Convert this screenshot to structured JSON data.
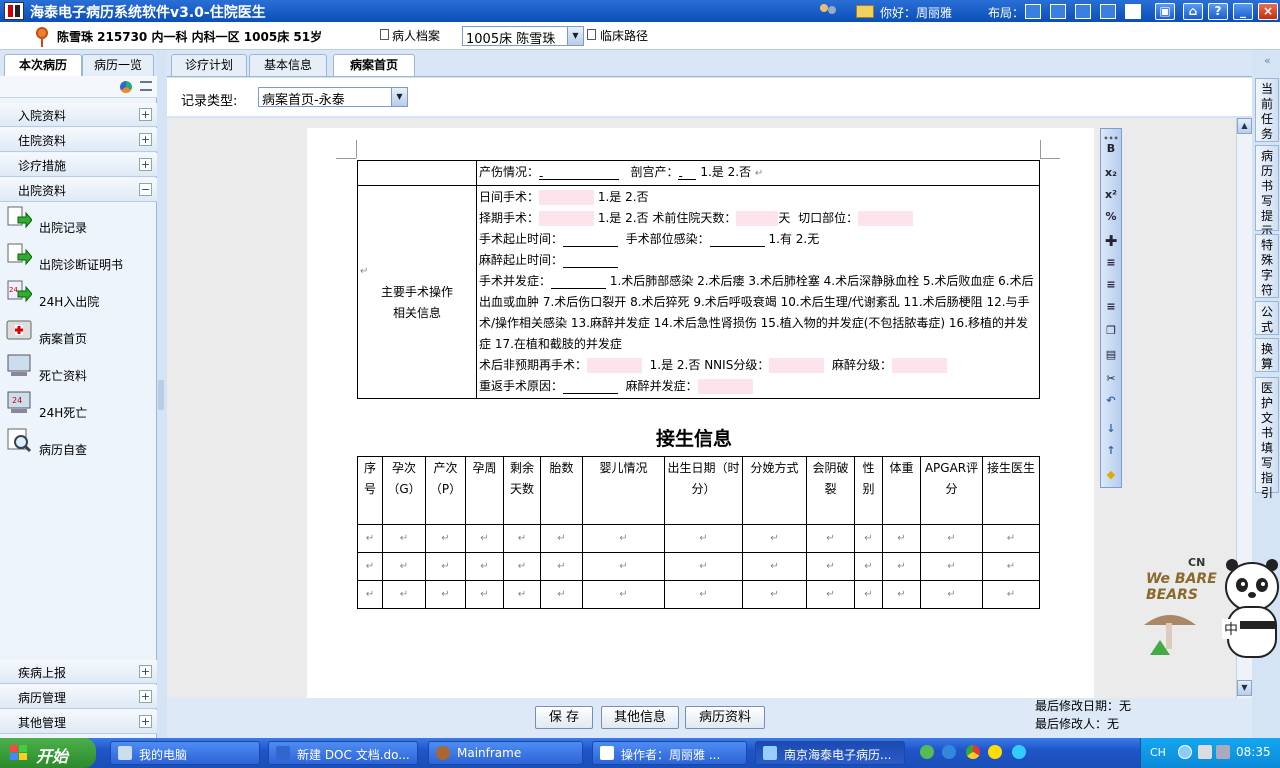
{
  "titlebar": {
    "title": "海泰电子病历系统软件v3.0-住院医生",
    "greeting": "你好：周丽雅",
    "layout_label": "布局：",
    "close": "×",
    "help": "?",
    "minimize": "_"
  },
  "patient": {
    "info": "陈雪珠 215730 内一科 内科一区 1005床 51岁",
    "archive_label": "病人档案",
    "bed_selected": "1005床 陈雪珠",
    "clinical_path": "临床路径"
  },
  "sidebar": {
    "tabs": [
      "本次病历",
      "病历一览"
    ],
    "groups": [
      "入院资料",
      "住院资料",
      "诊疗措施",
      "出院资料"
    ],
    "items": [
      "出院记录",
      "出院诊断证明书",
      "24H入出院",
      "病案首页",
      "死亡资料",
      "24H死亡",
      "病历自查"
    ],
    "bottom_groups": [
      "疾病上报",
      "病历管理",
      "其他管理"
    ]
  },
  "main_tabs": [
    "诊疗计划",
    "基本信息",
    "病案首页"
  ],
  "record_type": {
    "label": "记录类型:",
    "value": "病案首页-永泰"
  },
  "doc": {
    "delivery_label": "产伤情况：",
    "delivery_value": "-",
    "cesarean_label": "剖宫产：",
    "cesarean_value": "-",
    "cesarean_opts": "1.是 2.否",
    "op_label_1": "主要手术操作",
    "op_label_2": "相关信息",
    "day_op": "日间手术：",
    "day_op_opts": "1.是 2.否",
    "elective": "择期手术：",
    "elective_opts": "1.是 2.否",
    "preop_days": "术前住院天数：",
    "days_unit": "天",
    "incision": "切口部位：",
    "op_time": "手术起止时间：",
    "op_infection": "手术部位感染：",
    "op_infection_opts": "1.有 2.无",
    "anes_time": "麻醉起止时间：",
    "complication": "手术并发症：",
    "complication_list": "1.术后肺部感染 2.术后瘘 3.术后肺栓塞 4.术后深静脉血栓 5.术后败血症 6.术后出血或血肿 7.术后伤口裂开 8.术后猝死 9.术后呼吸衰竭 10.术后生理/代谢紊乱 11.术后肠梗阻 12.与手术/操作相关感染 13.麻醉并发症 14.术后急性肾损伤 15.植入物的并发症(不包括脓毒症) 16.移植的并发症 17.在植和截肢的并发症",
    "unplanned": "术后非预期再手术：",
    "unplanned_opts": "1.是 2.否",
    "nnis": "NNIS分级：",
    "anes_grade": "麻醉分级：",
    "reop_reason": "重返手术原因：",
    "anes_comp": "麻醉并发症：",
    "birth_title": "接生信息",
    "birth_headers": [
      "序号",
      "孕次（G）",
      "产次（P）",
      "孕周",
      "剩余天数",
      "胎数",
      "婴儿情况",
      "出生日期（时分）",
      "分娩方式",
      "会阴破裂",
      "性别",
      "体重",
      "APGAR评分",
      "接生医生"
    ],
    "para_mark": "↵"
  },
  "buttons": [
    "保 存",
    "其他信息",
    "病历资料"
  ],
  "lastmod": {
    "date_label": "最后修改日期：无",
    "user_label": "最后修改人：无"
  },
  "right_tabs": [
    "当前任务",
    "病历书写提示",
    "特殊字符",
    "公式",
    "换算",
    "医护文书填写指引"
  ],
  "vtoolbar": [
    "B",
    "x₂",
    "x²"
  ],
  "taskbar": {
    "start": "开始",
    "tasks": [
      "我的电脑",
      "新建 DOC 文档.do...",
      "Mainframe",
      "操作者：周丽雅 ...",
      "南京海泰电子病历..."
    ],
    "lang": "CH",
    "clock": "08:35"
  },
  "mascot": {
    "brand": "We BARE BEARS",
    "cn": "CN",
    "text": "中"
  },
  "colors": {
    "titlebar": "#0a4fb8",
    "pink_field": "#fde4ec",
    "taskbar": "#1f55c8"
  }
}
